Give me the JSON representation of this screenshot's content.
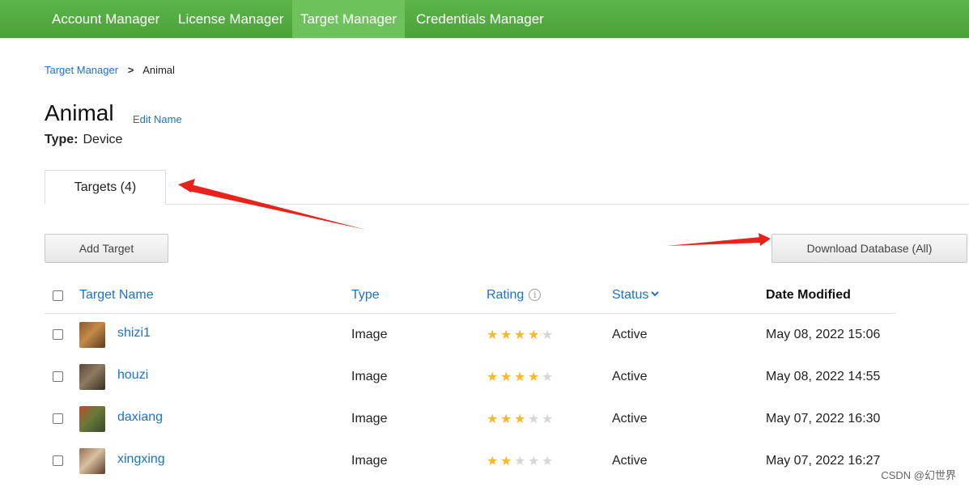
{
  "nav": {
    "items": [
      "Account Manager",
      "License Manager",
      "Target Manager",
      "Credentials Manager"
    ],
    "active": "Target Manager"
  },
  "breadcrumb": {
    "parent": "Target Manager",
    "separator": ">",
    "current": "Animal"
  },
  "database": {
    "name": "Animal",
    "edit_name_label": "Edit Name",
    "type_label": "Type:",
    "type_value": "Device"
  },
  "tabs": {
    "targets_label": "Targets (4)"
  },
  "actions": {
    "add_target_label": "Add Target",
    "download_label": "Download Database (All)"
  },
  "table": {
    "headers": {
      "target_name": "Target Name",
      "type": "Type",
      "rating": "Rating",
      "status": "Status",
      "date_modified": "Date Modified"
    },
    "rating_max": 5,
    "rows": [
      {
        "name": "shizi1",
        "type": "Image",
        "rating": 4,
        "status": "Active",
        "date_modified": "May 08, 2022 15:06",
        "thumb_colors": [
          "#8a5a2c",
          "#c48a4a",
          "#5d3b1a"
        ]
      },
      {
        "name": "houzi",
        "type": "Image",
        "rating": 4,
        "status": "Active",
        "date_modified": "May 08, 2022 14:55",
        "thumb_colors": [
          "#5a4a3a",
          "#8e7a60",
          "#3a2f24"
        ]
      },
      {
        "name": "daxiang",
        "type": "Image",
        "rating": 3,
        "status": "Active",
        "date_modified": "May 07, 2022 16:30",
        "thumb_colors": [
          "#b5502a",
          "#6a7a3a",
          "#3a4a2a"
        ]
      },
      {
        "name": "xingxing",
        "type": "Image",
        "rating": 2,
        "status": "Active",
        "date_modified": "May 07, 2022 16:27",
        "thumb_colors": [
          "#9a7050",
          "#d8c0a0",
          "#5a3a28"
        ]
      }
    ]
  },
  "watermark": "CSDN @幻世界",
  "colors": {
    "nav_green": "#4aa23a",
    "link_blue": "#1a73c8",
    "star_filled": "#f5b82e",
    "star_empty": "#d6d6d6",
    "annotation_arrow": "#e8231c"
  }
}
